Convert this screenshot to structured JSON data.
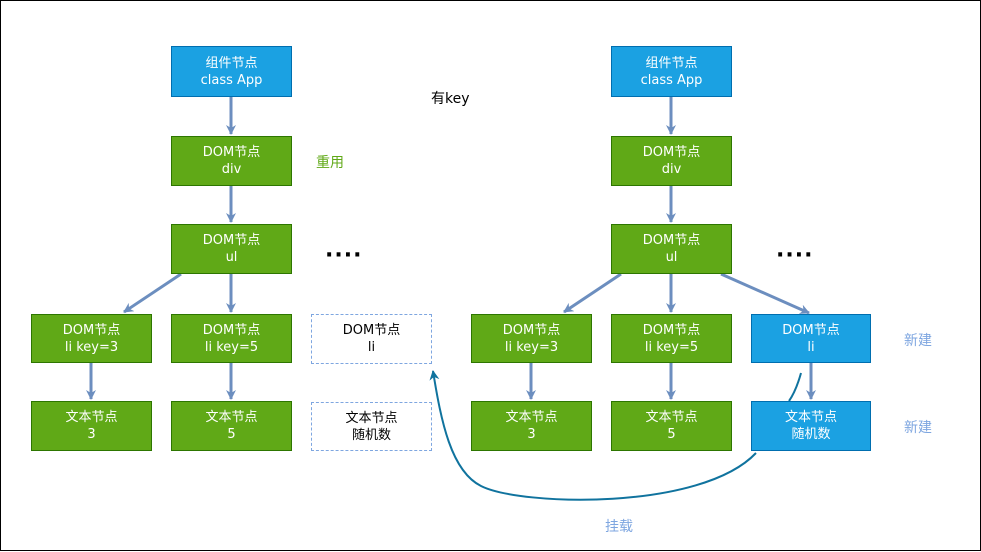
{
  "colors": {
    "node_green": "#60a917",
    "node_blue": "#1ba1e2",
    "edge": "#6c8ebf",
    "mount_arrow": "#10739e",
    "label_green": "#60a917",
    "label_blue": "#7ea6e0"
  },
  "title": "有key",
  "left_tree": {
    "component": {
      "line1": "组件节点",
      "line2": "class App"
    },
    "div": {
      "line1": "DOM节点",
      "line2": "div"
    },
    "ul": {
      "line1": "DOM节点",
      "line2": "ul"
    },
    "li_3": {
      "line1": "DOM节点",
      "line2": "li key=3"
    },
    "li_5": {
      "line1": "DOM节点",
      "line2": "li key=5"
    },
    "text_3": {
      "line1": "文本节点",
      "line2": "3"
    },
    "text_5": {
      "line1": "文本节点",
      "line2": "5"
    },
    "placeholder_li": {
      "line1": "DOM节点",
      "line2": "li"
    },
    "placeholder_text": {
      "line1": "文本节点",
      "line2": "随机数"
    },
    "ellipsis": "····",
    "reuse_label": "重用"
  },
  "right_tree": {
    "component": {
      "line1": "组件节点",
      "line2": "class App"
    },
    "div": {
      "line1": "DOM节点",
      "line2": "div"
    },
    "ul": {
      "line1": "DOM节点",
      "line2": "ul"
    },
    "li_3": {
      "line1": "DOM节点",
      "line2": "li key=3"
    },
    "li_5": {
      "line1": "DOM节点",
      "line2": "li key=5"
    },
    "li_new": {
      "line1": "DOM节点",
      "line2": "li"
    },
    "text_3": {
      "line1": "文本节点",
      "line2": "3"
    },
    "text_5": {
      "line1": "文本节点",
      "line2": "5"
    },
    "text_new": {
      "line1": "文本节点",
      "line2": "随机数"
    },
    "ellipsis": "····",
    "new_label_li": "新建",
    "new_label_text": "新建"
  },
  "mount_label": "挂载"
}
